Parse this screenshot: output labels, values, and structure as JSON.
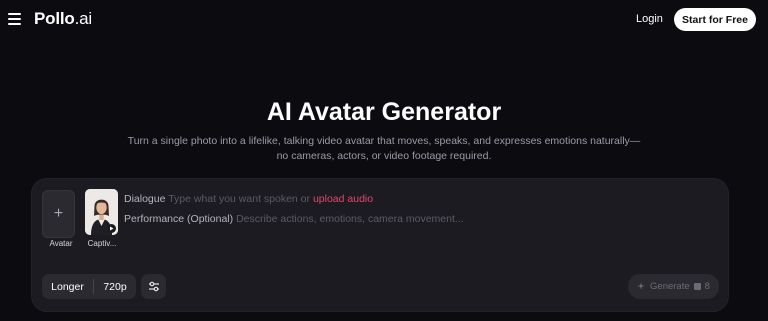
{
  "header": {
    "logo_main": "Pollo",
    "logo_suffix": ".ai",
    "login_label": "Login",
    "start_label": "Start for Free"
  },
  "hero": {
    "title": "AI Avatar Generator",
    "subtitle_line1": "Turn a single photo into a lifelike, talking video avatar that moves, speaks, and expresses emotions naturally—",
    "subtitle_line2": "no cameras, actors, or video footage required."
  },
  "composer": {
    "avatar_label": "Avatar",
    "preset_label": "Captiv...",
    "dialogue_label": "Dialogue",
    "dialogue_placeholder": "Type what you want spoken or",
    "upload_link": "upload audio",
    "performance_label": "Performance (Optional)",
    "performance_placeholder": "Describe actions, emotions, camera movement...",
    "duration_option": "Longer",
    "resolution_option": "720p",
    "generate_label": "Generate",
    "credit_cost": "8"
  },
  "colors": {
    "background": "#0c0b10",
    "card": "#1c1b21",
    "accent_link": "#e0486d"
  }
}
